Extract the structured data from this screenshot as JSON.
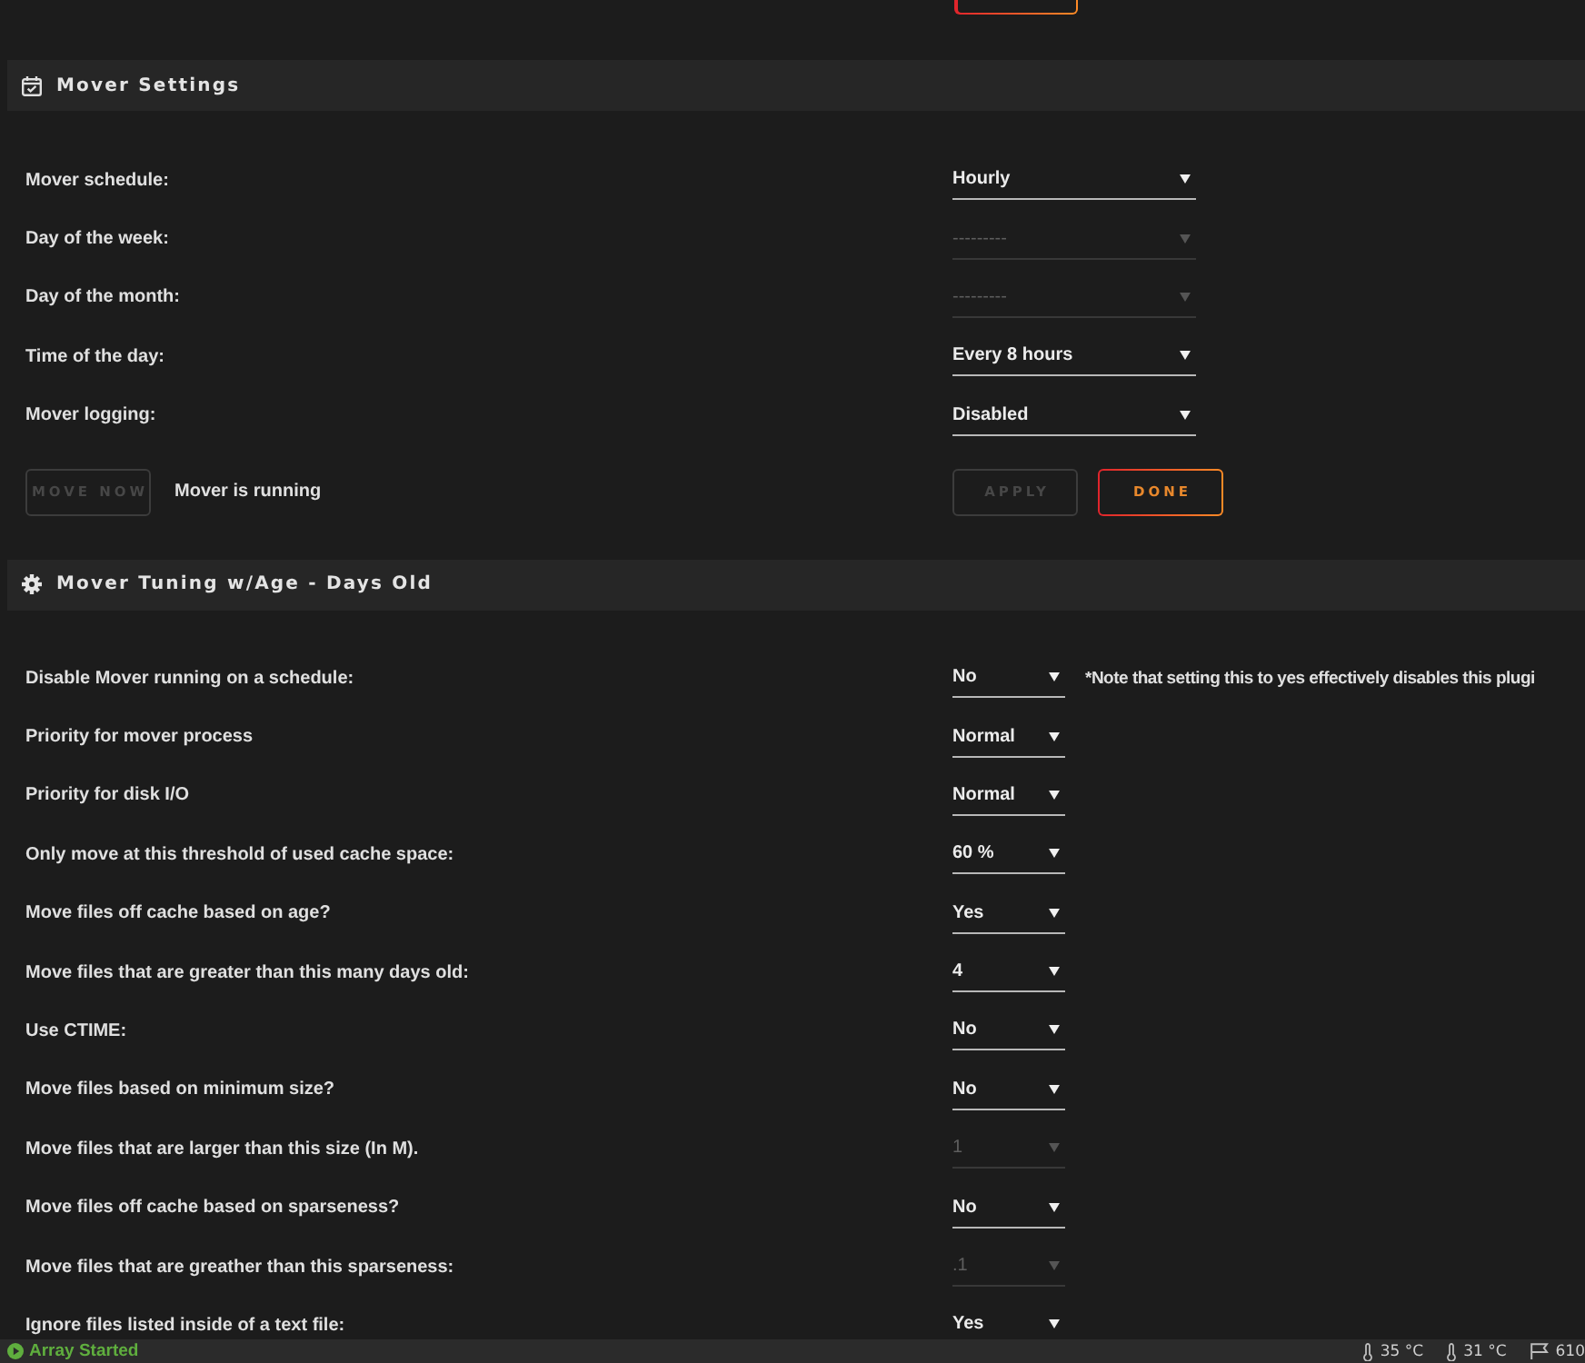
{
  "sections": [
    {
      "kind": "schedule",
      "title": "Mover Settings",
      "rows": [
        {
          "label": "Mover schedule:",
          "value": "Hourly",
          "disabled": false
        },
        {
          "label": "Day of the week:",
          "value": "---------",
          "disabled": true
        },
        {
          "label": "Day of the month:",
          "value": "---------",
          "disabled": true
        },
        {
          "label": "Time of the day:",
          "value": "Every 8 hours",
          "disabled": false
        },
        {
          "label": "Mover logging:",
          "value": "Disabled",
          "disabled": false
        }
      ],
      "actions": {
        "move_button": {
          "label": "MOVE NOW",
          "disabled": true
        },
        "status": "Mover is running",
        "buttons": [
          {
            "label": "APPLY",
            "kind": "plain",
            "disabled": true
          },
          {
            "label": "DONE",
            "kind": "accent",
            "disabled": false
          }
        ]
      }
    },
    {
      "kind": "tuning",
      "title": "Mover Tuning w/Age - Days Old",
      "rows": [
        {
          "label": "Disable Mover running on a schedule:",
          "value": "No",
          "disabled": false,
          "note": "*Note that setting this to yes effectively disables this plugi"
        },
        {
          "label": "Priority for mover process",
          "value": "Normal",
          "disabled": false
        },
        {
          "label": "Priority for disk I/O",
          "value": "Normal",
          "disabled": false
        },
        {
          "label": "Only move at this threshold of used cache space:",
          "value": "60 %",
          "disabled": false
        },
        {
          "label": "Move files off cache based on age?",
          "value": "Yes",
          "disabled": false
        },
        {
          "label": "Move files that are greater than this many days old:",
          "value": "4",
          "disabled": false
        },
        {
          "label": "Use CTIME:",
          "value": "No",
          "disabled": false
        },
        {
          "label": "Move files based on minimum size?",
          "value": "No",
          "disabled": false
        },
        {
          "label": "Move files that are larger than this size (In M).",
          "value": "1",
          "disabled": true
        },
        {
          "label": "Move files off cache based on sparseness?",
          "value": "No",
          "disabled": false
        },
        {
          "label": "Move files that are greather than this sparseness:",
          "value": ".1",
          "disabled": true
        },
        {
          "label": "Ignore files listed inside of a text file:",
          "value": "Yes",
          "disabled": false
        }
      ]
    }
  ],
  "status_bar": {
    "array_status": "Array Started",
    "readings": [
      {
        "kind": "temperature",
        "text": "35 °C"
      },
      {
        "kind": "temperature",
        "text": "31 °C"
      },
      {
        "kind": "flag",
        "text": "610"
      }
    ]
  }
}
